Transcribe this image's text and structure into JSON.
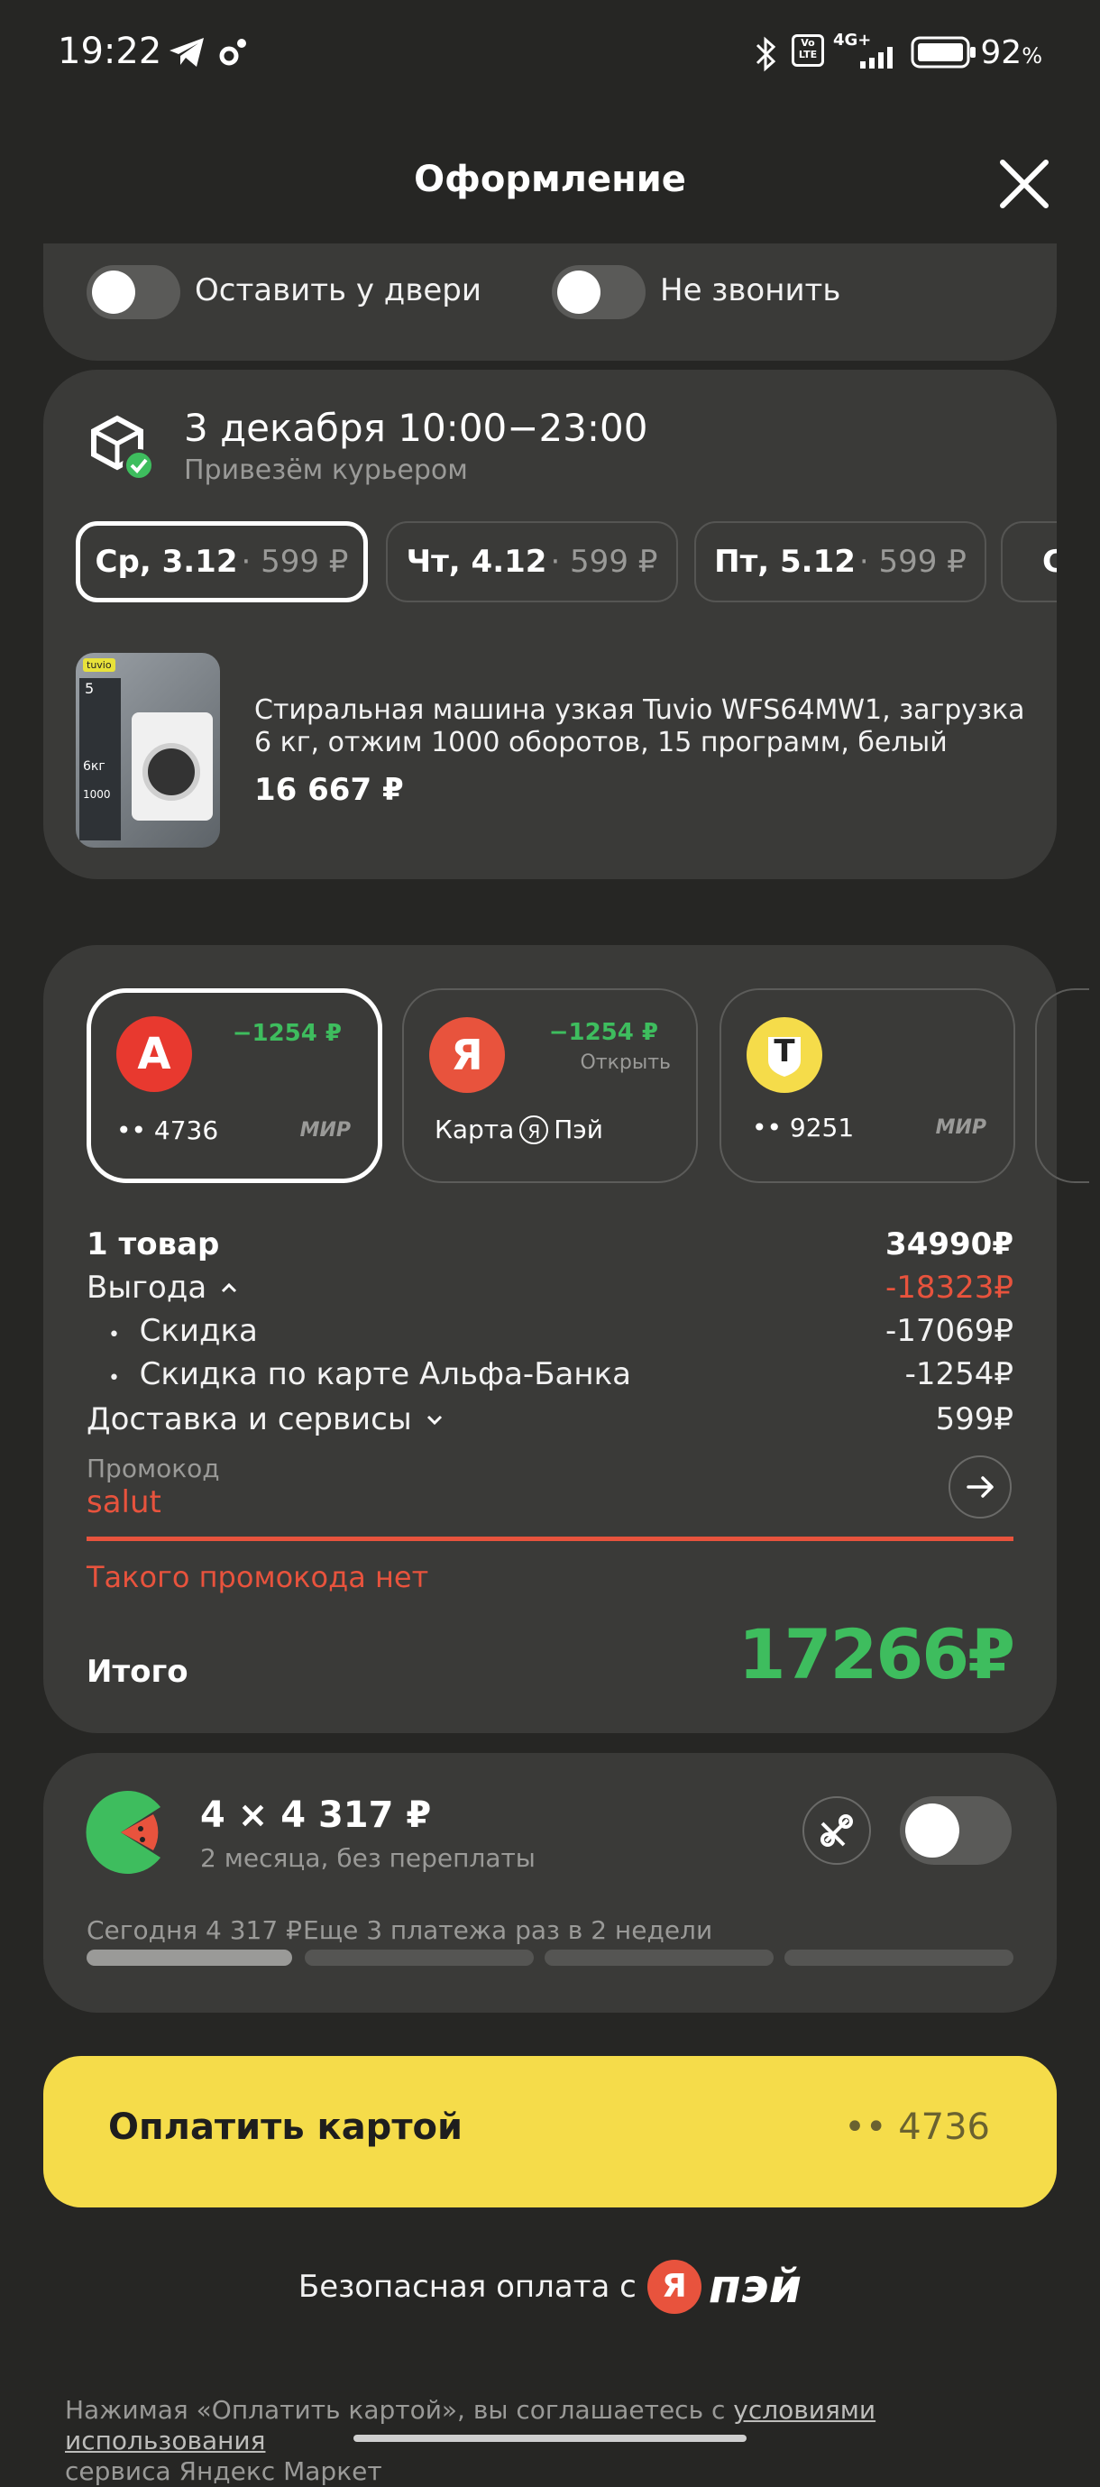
{
  "status_bar": {
    "time": "19:22",
    "network": "4G+",
    "volte": "Vo LTE",
    "battery": "92",
    "battery_suffix": "%"
  },
  "header": {
    "title": "Оформление"
  },
  "delivery_options": {
    "leave_at_door": "Оставить у двери",
    "dont_call": "Не звонить"
  },
  "delivery": {
    "date_title": "3 декабря 10:00−23:00",
    "subtitle": "Привезём курьером",
    "dates": [
      {
        "day": "Ср, 3.12",
        "price": "· 599 ₽"
      },
      {
        "day": "Чт, 4.12",
        "price": "· 599 ₽"
      },
      {
        "day": "Пт, 5.12",
        "price": "· 599 ₽"
      },
      {
        "day": "С",
        "price": ""
      }
    ],
    "product": {
      "name": "Стиральная машина узкая Tuvio WFS64MW1, загрузка 6 кг, отжим 1000 оборотов, 15 программ, белый",
      "price": "16 667 ₽",
      "image_texts": {
        "brand": "tuvio",
        "load": "5",
        "kg": "6кг",
        "rpm": "1000"
      }
    }
  },
  "payment_methods": [
    {
      "bank": "alfa",
      "letter": "А",
      "discount": "−1254 ₽",
      "number": "•• 4736",
      "system": "МИР"
    },
    {
      "bank": "yandex",
      "letter": "Я",
      "discount": "−1254 ₽",
      "action": "Открыть",
      "name_prefix": "Карта",
      "name_suffix": "Пэй"
    },
    {
      "bank": "tbank",
      "letter": "T",
      "number": "•• 9251",
      "system": "МИР"
    }
  ],
  "summary": {
    "items_label": "1 товар",
    "items_value": "34990₽",
    "benefit_label": "Выгода",
    "benefit_value": "-18323₽",
    "discount_label": "Скидка",
    "discount_value": "-17069₽",
    "card_discount_label": "Скидка по карте Альфа-Банка",
    "card_discount_value": "-1254₽",
    "delivery_label": "Доставка и сервисы",
    "delivery_value": "599₽",
    "promo_label": "Промокод",
    "promo_value": "salut",
    "promo_error": "Такого промокода нет",
    "total_label": "Итого",
    "total_value": "17266₽"
  },
  "split": {
    "title": "4 × 4 317 ₽",
    "subtitle": "2 месяца, без переплаты",
    "today": "Сегодня 4 317 ₽",
    "rest": "Еще 3 платежа раз в 2 недели",
    "paid_fraction": 0.25
  },
  "pay_button": {
    "label": "Оплатить картой",
    "card": "•• 4736"
  },
  "secure": {
    "text": "Безопасная оплата с",
    "logo_letter": "Я",
    "logo_text": "пэй"
  },
  "legal": {
    "text": "Нажимая «Оплатить картой», вы соглашаетесь с ",
    "link": "условиями использования",
    "text2": "сервиса Яндекс Маркет"
  },
  "colors": {
    "background": "#262624",
    "card": "#3a3a38",
    "green": "#3ebd5e",
    "red": "#e8533d",
    "yellow": "#f5dc4a"
  }
}
